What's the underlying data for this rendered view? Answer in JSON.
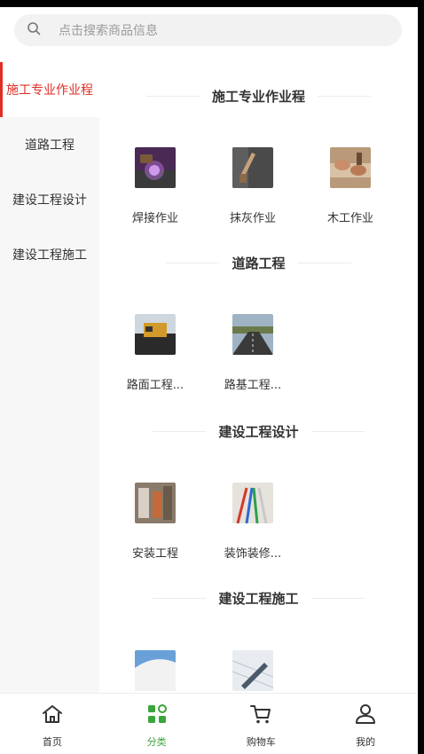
{
  "search": {
    "placeholder": "点击搜索商品信息",
    "icon": "search-icon"
  },
  "sidebar": {
    "active_index": 0,
    "items": [
      {
        "label": "施工专业作业程"
      },
      {
        "label": "道路工程"
      },
      {
        "label": "建设工程设计"
      },
      {
        "label": "建设工程施工"
      }
    ]
  },
  "sections": [
    {
      "title": "施工专业作业程",
      "items": [
        {
          "label": "焊接作业"
        },
        {
          "label": "抹灰作业"
        },
        {
          "label": "木工作业"
        }
      ]
    },
    {
      "title": "道路工程",
      "items": [
        {
          "label": "路面工程..."
        },
        {
          "label": "路基工程..."
        }
      ]
    },
    {
      "title": "建设工程设计",
      "items": [
        {
          "label": "安装工程"
        },
        {
          "label": "装饰装修..."
        }
      ]
    },
    {
      "title": "建设工程施工",
      "items": [
        {
          "label": ""
        },
        {
          "label": ""
        }
      ]
    }
  ],
  "tabbar": {
    "active_index": 1,
    "accent": "#3aa53a",
    "tabs": [
      {
        "label": "首页",
        "icon": "home-icon"
      },
      {
        "label": "分类",
        "icon": "category-icon"
      },
      {
        "label": "购物车",
        "icon": "cart-icon"
      },
      {
        "label": "我的",
        "icon": "profile-icon"
      }
    ]
  },
  "colors": {
    "active_red": "#e02e24",
    "sidebar_bg": "#f7f7f7",
    "text": "#333333"
  }
}
